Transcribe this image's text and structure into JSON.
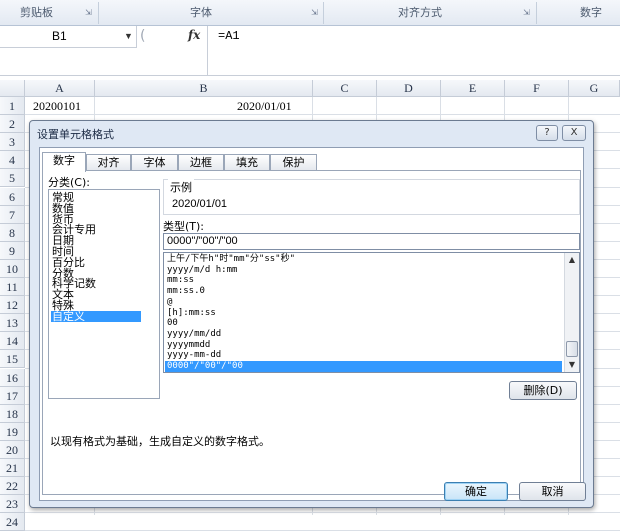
{
  "ribbon": {
    "groups": [
      "剪贴板",
      "字体",
      "对齐方式",
      "数字"
    ]
  },
  "formula_bar": {
    "name_box": "B1",
    "fx_label": "fx",
    "formula": "=A1"
  },
  "sheet": {
    "columns": [
      "A",
      "B",
      "C",
      "D",
      "E",
      "F",
      "G"
    ],
    "rows": [
      "1",
      "2",
      "3",
      "4",
      "5",
      "6",
      "7",
      "8",
      "9",
      "10",
      "11",
      "12",
      "13",
      "14",
      "15",
      "16",
      "17",
      "18",
      "19",
      "20",
      "21",
      "22",
      "23",
      "24"
    ],
    "cells": {
      "A1": "20200101",
      "B1": "2020/01/01"
    }
  },
  "dialog": {
    "title": "设置单元格格式",
    "help_label": "?",
    "close_label": "X",
    "tabs": [
      "数字",
      "对齐",
      "字体",
      "边框",
      "填充",
      "保护"
    ],
    "active_tab": "数字",
    "category_label": "分类(C):",
    "categories": [
      "常规",
      "数值",
      "货币",
      "会计专用",
      "日期",
      "时间",
      "百分比",
      "分数",
      "科学记数",
      "文本",
      "特殊",
      "自定义"
    ],
    "selected_category": "自定义",
    "sample_label": "示例",
    "sample_value": "2020/01/01",
    "type_label": "类型(T):",
    "type_value": "0000\"/\"00\"/\"00",
    "type_list": [
      "上午/下午h\"时\"mm\"分\"ss\"秒\"",
      "yyyy/m/d h:mm",
      "mm:ss",
      "mm:ss.0",
      "@",
      "[h]:mm:ss",
      "00",
      "yyyy/mm/dd",
      "yyyymmdd",
      "yyyy-mm-dd",
      "0000\"/\"00\"/\"00"
    ],
    "selected_type": "0000\"/\"00\"/\"00",
    "delete_label": "删除(D)",
    "description": "以现有格式为基础，生成自定义的数字格式。",
    "ok_label": "确定",
    "cancel_label": "取消"
  }
}
